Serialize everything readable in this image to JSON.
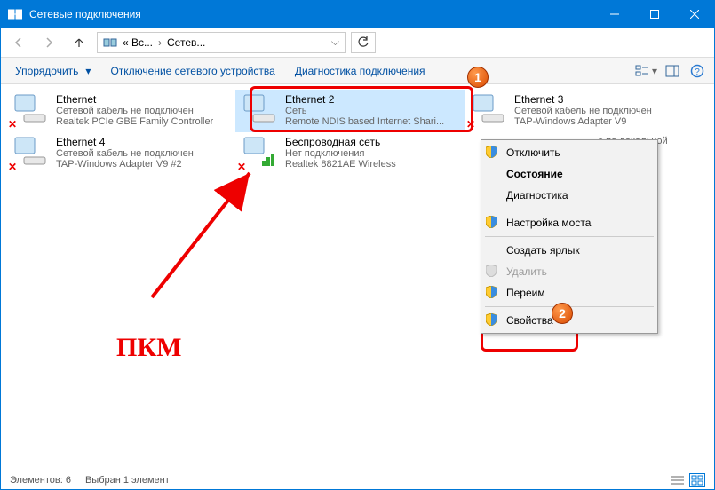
{
  "title": "Сетевые подключения",
  "breadcrumb": {
    "p1": "« Вс...",
    "p2": "Сетев..."
  },
  "toolbar": {
    "organize": "Упорядочить",
    "disable": "Отключение сетевого устройства",
    "diagnose": "Диагностика подключения"
  },
  "connections": [
    {
      "name": "Ethernet",
      "status": "Сетевой кабель не подключен",
      "device": "Realtek PCIe GBE Family Controller",
      "cross": true
    },
    {
      "name": "Ethernet 2",
      "status": "Сеть",
      "device": "Remote NDIS based Internet Shari...",
      "cross": false,
      "selected": true
    },
    {
      "name": "Ethernet 3",
      "status": "Сетевой кабель не подключен",
      "device": "TAP-Windows Adapter V9",
      "cross": true
    },
    {
      "name": "Ethernet 4",
      "status": "Сетевой кабель не подключен",
      "device": "TAP-Windows Adapter V9 #2",
      "cross": true
    },
    {
      "name": "Беспроводная сеть",
      "status": "Нет подключения",
      "device": "Realtek 8821AE Wireless",
      "cross": true,
      "wifi": true
    },
    {
      "name_trunc": "е по локальной"
    }
  ],
  "context_menu": {
    "disable": "Отключить",
    "status": "Состояние",
    "diagnose": "Диагностика",
    "bridge": "Настройка моста",
    "shortcut": "Создать ярлык",
    "delete": "Удалить",
    "rename": "Переим",
    "properties": "Свойства"
  },
  "statusbar": {
    "count": "Элементов: 6",
    "selected": "Выбран 1 элемент"
  },
  "annotations": {
    "pkmlabel": "ПКМ",
    "balloon1": "1",
    "balloon2": "2"
  }
}
